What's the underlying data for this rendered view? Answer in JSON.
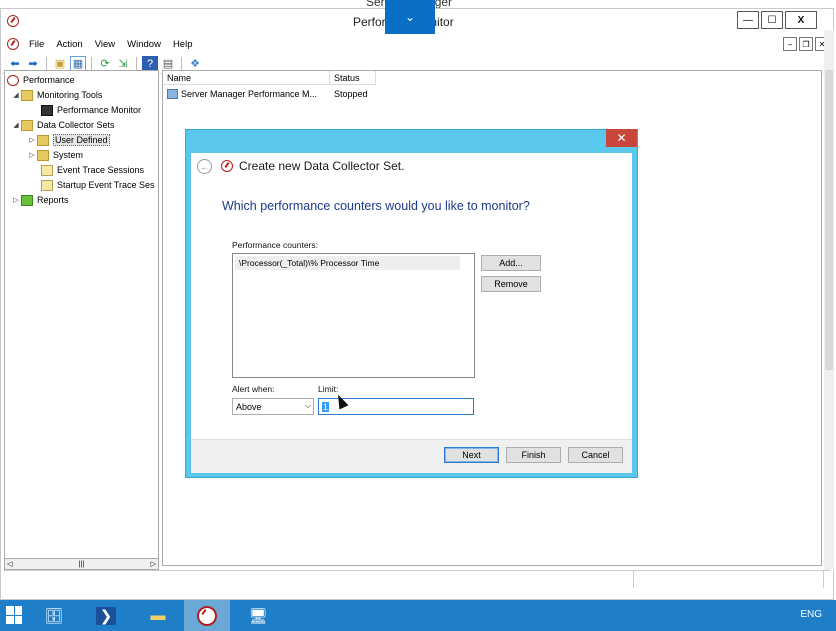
{
  "behind_window": {
    "title": "Server Manager"
  },
  "window": {
    "title": "Performance Monitor",
    "title_visible_left": "Perfor",
    "title_visible_right": "onitor",
    "buttons": {
      "minimize": "—",
      "maximize": "☐",
      "close": "X"
    }
  },
  "menu": [
    "File",
    "Action",
    "View",
    "Window",
    "Help"
  ],
  "tree": {
    "root": "Performance",
    "monitoring_tools": "Monitoring Tools",
    "performance_monitor": "Performance Monitor",
    "data_collector_sets": "Data Collector Sets",
    "user_defined": "User Defined",
    "system": "System",
    "event_trace_sessions": "Event Trace Sessions",
    "startup_event_trace": "Startup Event Trace Ses",
    "reports": "Reports"
  },
  "list": {
    "columns": [
      "Name",
      "Status"
    ],
    "rows": [
      {
        "name": "Server Manager Performance M...",
        "status": "Stopped"
      }
    ]
  },
  "wizard": {
    "title": "Create new Data Collector Set.",
    "question": "Which performance counters would you like to monitor?",
    "counters_label": "Performance counters:",
    "counters": [
      "\\Processor(_Total)\\% Processor Time"
    ],
    "add_button": "Add...",
    "remove_button": "Remove",
    "alert_label": "Alert when:",
    "alert_value": "Above",
    "limit_label": "Limit:",
    "limit_value": "1",
    "next_button": "Next",
    "finish_button": "Finish",
    "cancel_button": "Cancel"
  },
  "taskbar": {
    "language": "ENG"
  },
  "colors": {
    "dialog_frame": "#5ac8ec",
    "taskbar": "#1e7ec8",
    "question_text": "#1e3a8a",
    "close_red": "#c9463d"
  }
}
